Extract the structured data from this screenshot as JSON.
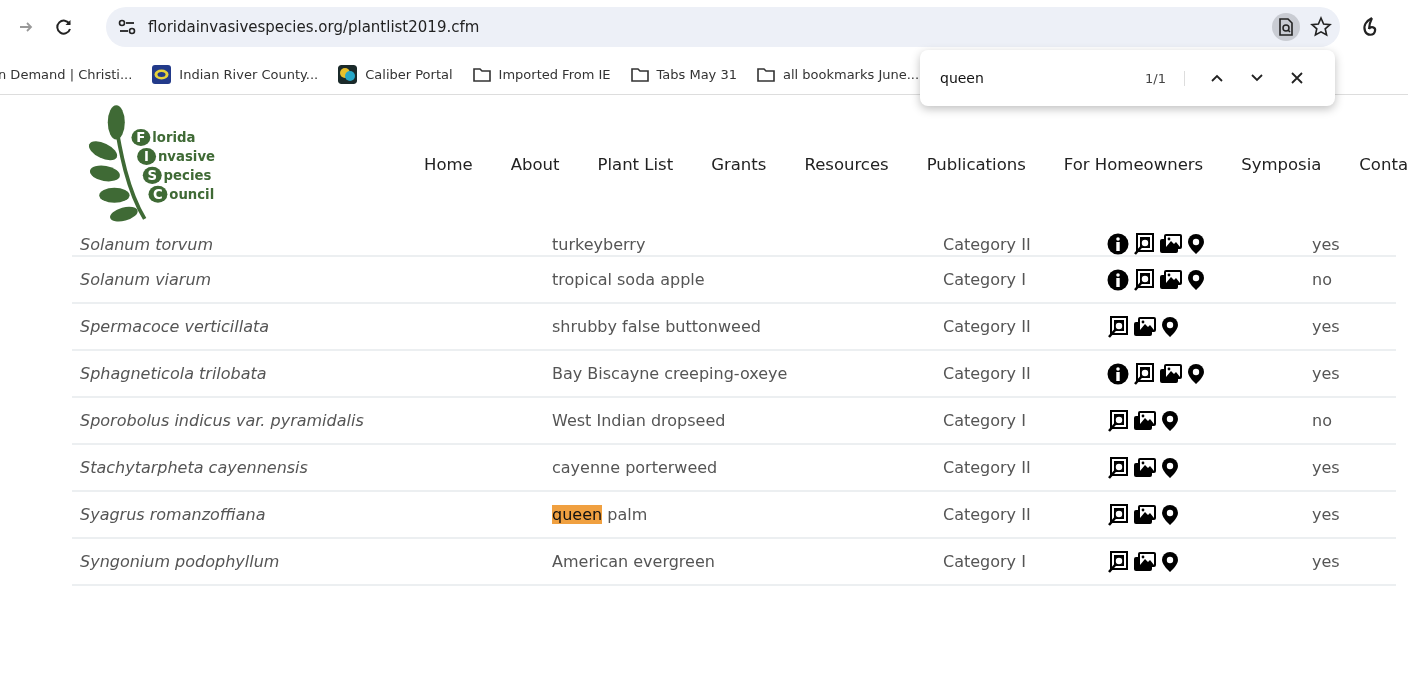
{
  "browser": {
    "url": "floridainvasivespecies.org/plantlist2019.cfm",
    "bookmarks": [
      {
        "label": "n Demand | Christi...",
        "kind": "none"
      },
      {
        "label": "Indian River County...",
        "kind": "site"
      },
      {
        "label": "Caliber Portal",
        "kind": "site2"
      },
      {
        "label": "Imported From IE",
        "kind": "folder"
      },
      {
        "label": "Tabs May 31",
        "kind": "folder"
      },
      {
        "label": "all bookmarks June...",
        "kind": "folder"
      }
    ]
  },
  "find_bar": {
    "value": "queen",
    "count": "1/1"
  },
  "site": {
    "logo_lines": [
      {
        "initial": "F",
        "rest": "lorida"
      },
      {
        "initial": "I",
        "rest": "nvasive"
      },
      {
        "initial": "S",
        "rest": "pecies"
      },
      {
        "initial": "C",
        "rest": "ouncil"
      }
    ],
    "nav": [
      "Home",
      "About",
      "Plant List",
      "Grants",
      "Resources",
      "Publications",
      "For Homeowners",
      "Symposia",
      "Conta"
    ]
  },
  "table": {
    "rows": [
      {
        "scientific": "Solanum torvum",
        "common": "turkeyberry",
        "category": "Category II",
        "info": true,
        "native": "yes"
      },
      {
        "scientific": "Solanum viarum",
        "common": "tropical soda apple",
        "category": "Category I",
        "info": true,
        "native": "no"
      },
      {
        "scientific": "Spermacoce verticillata",
        "common": "shrubby false buttonweed",
        "category": "Category II",
        "info": false,
        "native": "yes"
      },
      {
        "scientific": "Sphagneticola trilobata",
        "common": "Bay Biscayne creeping-oxeye",
        "category": "Category II",
        "info": true,
        "native": "yes"
      },
      {
        "scientific": "Sporobolus indicus var. pyramidalis",
        "common": "West Indian dropseed",
        "category": "Category I",
        "info": false,
        "native": "no"
      },
      {
        "scientific": "Stachytarpheta cayennensis",
        "common": "cayenne porterweed",
        "category": "Category II",
        "info": false,
        "native": "yes"
      },
      {
        "scientific": "Syagrus romanzoffiana",
        "common": "palm",
        "match": "queen",
        "category": "Category II",
        "info": false,
        "native": "yes"
      },
      {
        "scientific": "Syngonium podophyllum",
        "common": "American evergreen",
        "category": "Category I",
        "info": false,
        "native": "yes"
      }
    ]
  }
}
